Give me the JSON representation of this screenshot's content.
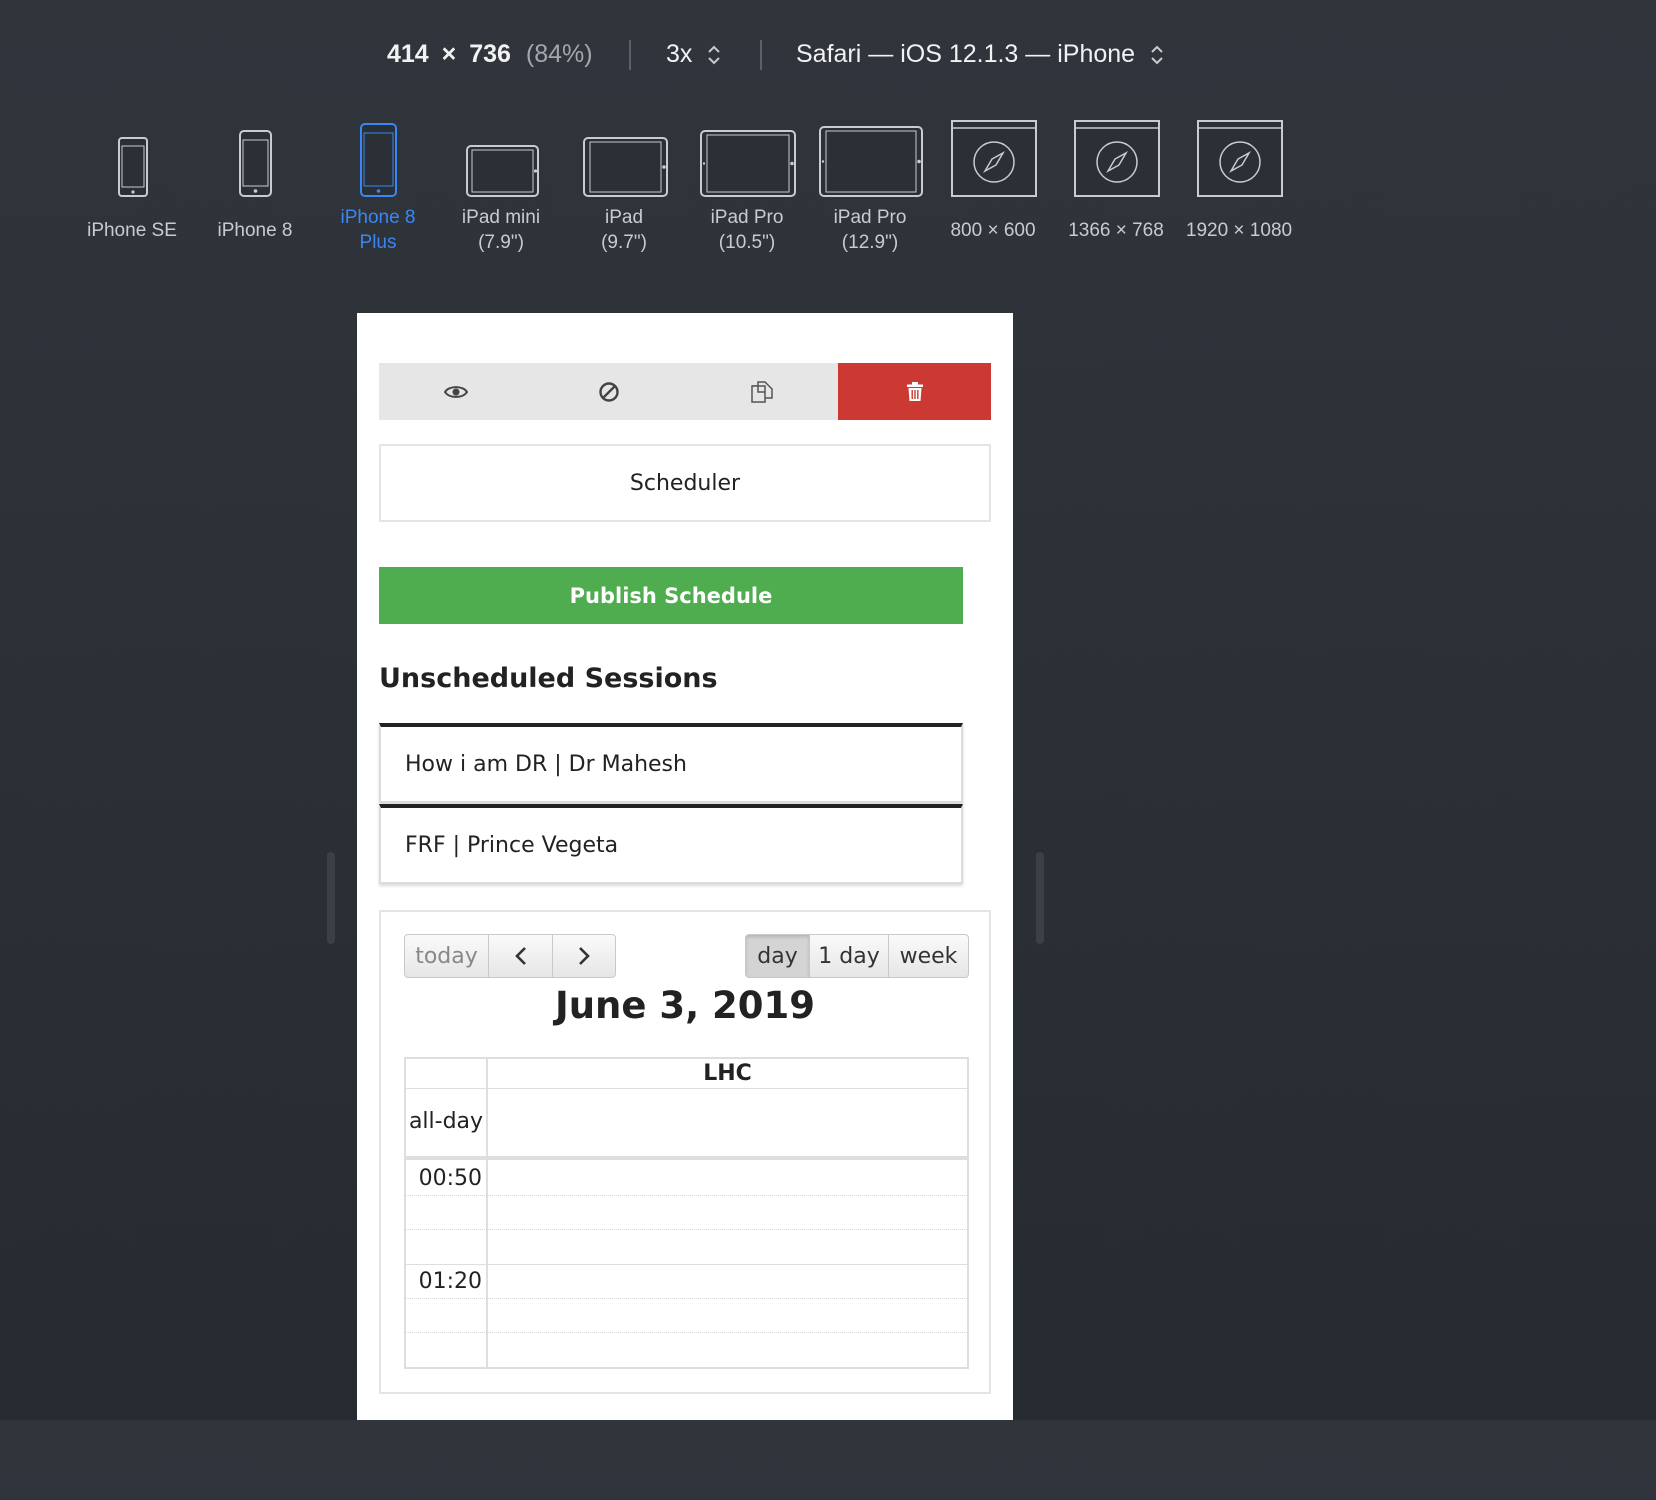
{
  "responsive_bar": {
    "width": "414",
    "times": "×",
    "height": "736",
    "zoom": "(84%)",
    "scale": "3x",
    "browser": "Safari — iOS 12.1.3 — iPhone"
  },
  "devices": [
    {
      "line1": "iPhone SE",
      "line2": "",
      "icon": "phone-icon",
      "active": false
    },
    {
      "line1": "iPhone 8",
      "line2": "",
      "icon": "phone-icon",
      "active": false
    },
    {
      "line1": "iPhone 8",
      "line2": "Plus",
      "icon": "phone-icon",
      "active": true
    },
    {
      "line1": "iPad mini",
      "line2": "(7.9\")",
      "icon": "tablet-icon",
      "active": false
    },
    {
      "line1": "iPad",
      "line2": "(9.7\")",
      "icon": "tablet-icon",
      "active": false
    },
    {
      "line1": "iPad Pro",
      "line2": "(10.5\")",
      "icon": "tablet-icon",
      "active": false
    },
    {
      "line1": "iPad Pro",
      "line2": "(12.9\")",
      "icon": "tablet-icon",
      "active": false
    },
    {
      "line1": "800 × 600",
      "line2": "",
      "icon": "compass-window-icon",
      "active": false
    },
    {
      "line1": "1366 × 768",
      "line2": "",
      "icon": "compass-window-icon",
      "active": false
    },
    {
      "line1": "1920 × 1080",
      "line2": "",
      "icon": "compass-window-icon",
      "active": false
    }
  ],
  "toolbar": {
    "buttons": [
      "eye-icon",
      "ban-icon",
      "copy-icon",
      "trash-icon"
    ],
    "delete_color": "#cc3832"
  },
  "page": {
    "scheduler_label": "Scheduler",
    "publish_label": "Publish Schedule",
    "publish_color": "#4fac4f",
    "unscheduled_title": "Unscheduled Sessions",
    "sessions": [
      "How i am DR | Dr Mahesh",
      "FRF | Prince Vegeta"
    ]
  },
  "calendar": {
    "today": "today",
    "prev": "‹",
    "next": "›",
    "views": [
      "day",
      "1 day",
      "week"
    ],
    "active_view": "day",
    "title": "June 3, 2019",
    "resource": "LHC",
    "allday": "all-day",
    "times": [
      "00:50",
      "01:20"
    ]
  }
}
